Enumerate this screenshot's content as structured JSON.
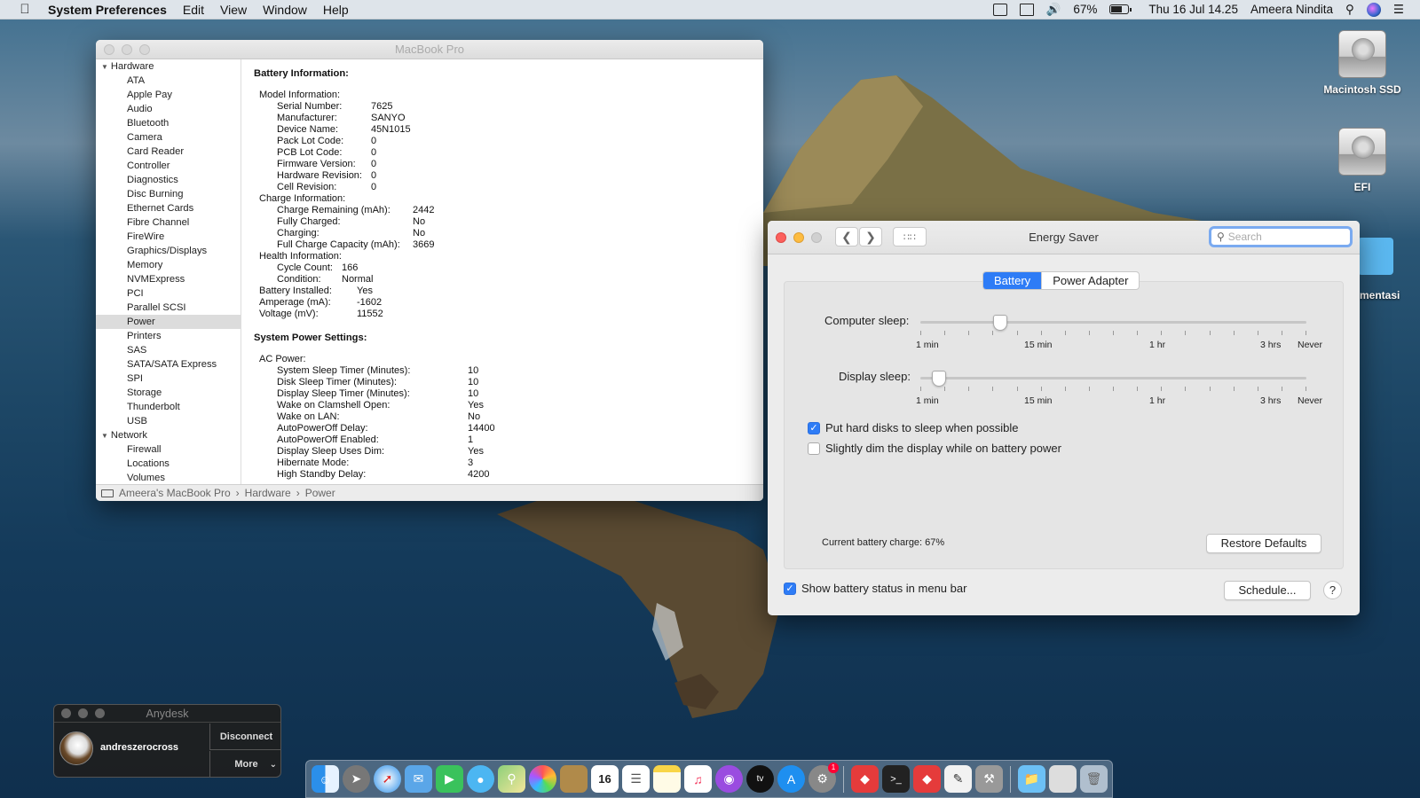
{
  "menubar": {
    "app": "System Preferences",
    "menus": [
      "Edit",
      "View",
      "Window",
      "Help"
    ],
    "battery_percent": "67%",
    "datetime": "Thu 16 Jul  14.25",
    "user": "Ameera Nindita"
  },
  "desktop": {
    "icons": [
      "Macintosh SSD",
      "EFI"
    ],
    "partial_label": "mentasi"
  },
  "sysinfo": {
    "title": "MacBook Pro",
    "hardware_label": "Hardware",
    "hardware_items": [
      "ATA",
      "Apple Pay",
      "Audio",
      "Bluetooth",
      "Camera",
      "Card Reader",
      "Controller",
      "Diagnostics",
      "Disc Burning",
      "Ethernet Cards",
      "Fibre Channel",
      "FireWire",
      "Graphics/Displays",
      "Memory",
      "NVMExpress",
      "PCI",
      "Parallel SCSI",
      "Power",
      "Printers",
      "SAS",
      "SATA/SATA Express",
      "SPI",
      "Storage",
      "Thunderbolt",
      "USB"
    ],
    "network_label": "Network",
    "network_items": [
      "Firewall",
      "Locations",
      "Volumes"
    ],
    "battery_heading": "Battery Information:",
    "model_info_label": "Model Information:",
    "model_info": [
      {
        "k": "Serial Number:",
        "v": "7625"
      },
      {
        "k": "Manufacturer:",
        "v": "SANYO"
      },
      {
        "k": "Device Name:",
        "v": "45N1015"
      },
      {
        "k": "Pack Lot Code:",
        "v": "0"
      },
      {
        "k": "PCB Lot Code:",
        "v": "0"
      },
      {
        "k": "Firmware Version:",
        "v": "0"
      },
      {
        "k": "Hardware Revision:",
        "v": "0"
      },
      {
        "k": "Cell Revision:",
        "v": "0"
      }
    ],
    "charge_info_label": "Charge Information:",
    "charge_info": [
      {
        "k": "Charge Remaining (mAh):",
        "v": "2442"
      },
      {
        "k": "Fully Charged:",
        "v": "No"
      },
      {
        "k": "Charging:",
        "v": "No"
      },
      {
        "k": "Full Charge Capacity (mAh):",
        "v": "3669"
      }
    ],
    "health_info_label": "Health Information:",
    "health_info": [
      {
        "k": "Cycle Count:",
        "v": "166"
      },
      {
        "k": "Condition:",
        "v": "Normal"
      }
    ],
    "battery_misc": [
      {
        "k": "Battery Installed:",
        "v": "Yes"
      },
      {
        "k": "Amperage (mA):",
        "v": "-1602"
      },
      {
        "k": "Voltage (mV):",
        "v": "11552"
      }
    ],
    "power_heading": "System Power Settings:",
    "ac_power_label": "AC Power:",
    "ac_power": [
      {
        "k": "System Sleep Timer (Minutes):",
        "v": "10"
      },
      {
        "k": "Disk Sleep Timer (Minutes):",
        "v": "10"
      },
      {
        "k": "Display Sleep Timer (Minutes):",
        "v": "10"
      },
      {
        "k": "Wake on Clamshell Open:",
        "v": "Yes"
      },
      {
        "k": "Wake on LAN:",
        "v": "No"
      },
      {
        "k": "AutoPowerOff Delay:",
        "v": "14400"
      },
      {
        "k": "AutoPowerOff Enabled:",
        "v": "1"
      },
      {
        "k": "Display Sleep Uses Dim:",
        "v": "Yes"
      },
      {
        "k": "Hibernate Mode:",
        "v": "3"
      },
      {
        "k": "High Standby Delay:",
        "v": "4200"
      }
    ],
    "breadcrumb": [
      "Ameera's MacBook Pro",
      "Hardware",
      "Power"
    ]
  },
  "energy": {
    "title": "Energy Saver",
    "search_placeholder": "Search",
    "tabs": [
      "Battery",
      "Power Adapter"
    ],
    "computer_sleep_label": "Computer sleep:",
    "display_sleep_label": "Display sleep:",
    "tick_labels": [
      "1 min",
      "15 min",
      "1 hr",
      "3 hrs",
      "Never"
    ],
    "computer_sleep_value": "15 min",
    "display_sleep_value": "1 min",
    "checkbox_disks": "Put hard disks to sleep when possible",
    "checkbox_disks_checked": true,
    "checkbox_dim": "Slightly dim the display while on battery power",
    "checkbox_dim_checked": false,
    "current_charge": "Current battery charge: 67%",
    "restore_button": "Restore Defaults",
    "show_status": "Show battery status in menu bar",
    "show_status_checked": true,
    "schedule_button": "Schedule...",
    "help_button": "?"
  },
  "anydesk": {
    "title": "Anydesk",
    "user": "andreszerocross",
    "disconnect": "Disconnect",
    "more": "More"
  },
  "dock": {
    "calendar_day": "16",
    "syspref_badge": "1"
  }
}
